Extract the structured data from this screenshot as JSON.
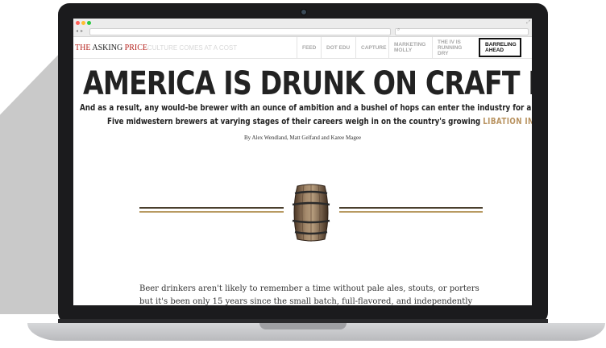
{
  "browser": {
    "nav_back": "◂",
    "nav_forward": "▸",
    "search_glyph": "⌕",
    "resize_glyph": "⤢"
  },
  "site": {
    "logo_part1": "THE ",
    "logo_part2": "ASKING ",
    "logo_part3": "PRICE",
    "tagline": "CULTURE COMES AT A COST",
    "accent_color": "#b5231e",
    "menu": [
      {
        "label": "FEED"
      },
      {
        "label": "DOT EDU"
      },
      {
        "label": "CAPTURE"
      },
      {
        "label": "MARKETING MOLLY"
      },
      {
        "label": "THE IV IS RUNNING DRY"
      },
      {
        "label": "BARRELING AHEAD",
        "selected": true
      }
    ]
  },
  "article": {
    "headline": "AMERICA IS DRUNK ON CRAFT BEER",
    "subhead_line1": "And as a result, any would-be brewer with an ounce of ambition and a bushel of hops can enter the industry for a typical week's",
    "subhead_line2_prefix": "Five midwestern brewers at varying stages of their careers weigh in on the country's growing ",
    "subhead_line2_accent": "LIBATION INFATUATION",
    "accent_color": "#b8925f",
    "byline": "By Alex Wendland, Matt Gelfand and Karee Magee",
    "image": "barrel-icon",
    "body": "Beer drinkers aren't likely to remember a time without pale ales, stouts, or porters but it's been only 15 years since the small batch, full-flavored, and independently owned"
  }
}
